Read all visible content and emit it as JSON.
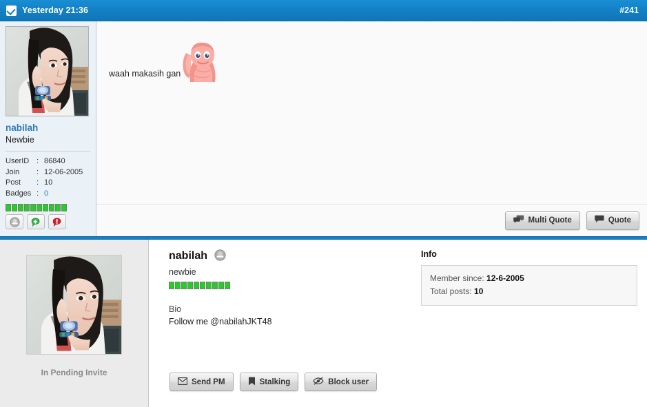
{
  "post_header": {
    "icon": "checkbox-checked-icon",
    "timestamp": "Yesterday 21:36",
    "post_number": "#241",
    "bg_color": "#1380c4"
  },
  "post": {
    "user": {
      "avatar_alt": "nabilah-avatar",
      "username": "nabilah",
      "usertitle": "Newbie",
      "stats": [
        {
          "label": "UserID",
          "sep": ":",
          "value": "86840",
          "is_link": false
        },
        {
          "label": "Join",
          "sep": ":",
          "value": "12-06-2005",
          "is_link": false
        },
        {
          "label": "Post",
          "sep": ":",
          "value": "10",
          "is_link": false
        },
        {
          "label": "Badges",
          "sep": ":",
          "value": "0",
          "is_link": true
        }
      ],
      "reputation_blocks": 10,
      "reputation_color": "#22d022",
      "action_icons": [
        {
          "name": "user-offline-icon",
          "title": "Offline"
        },
        {
          "name": "add-comment-icon",
          "title": "Add comment"
        },
        {
          "name": "report-post-icon",
          "title": "Report post"
        }
      ]
    },
    "message": {
      "text": "waah makasih gan",
      "emoticon": "pink-character-emoticon"
    },
    "buttons": [
      {
        "name": "multi-quote-button",
        "label": "Multi Quote",
        "icon": "multi-speech-bubble-icon"
      },
      {
        "name": "quote-button",
        "label": "Quote",
        "icon": "speech-bubble-icon"
      }
    ]
  },
  "profile_card": {
    "avatar_alt": "nabilah-large-avatar",
    "pending_status": "In Pending Invite",
    "name": "nabilah",
    "status_icon": "offline-status-icon",
    "usertitle": "newbie",
    "reputation_blocks": 10,
    "bio_label": "Bio",
    "bio_text": "Follow me @nabilahJKT48",
    "info": {
      "heading": "Info",
      "rows": [
        {
          "label": "Member since:",
          "value": "12-6-2005"
        },
        {
          "label": "Total posts:",
          "value": "10"
        }
      ]
    },
    "actions": [
      {
        "name": "send-pm-button",
        "label": "Send PM",
        "icon": "envelope-icon"
      },
      {
        "name": "stalking-button",
        "label": "Stalking",
        "icon": "bookmark-icon"
      },
      {
        "name": "block-user-button",
        "label": "Block user",
        "icon": "eye-slash-icon"
      }
    ]
  }
}
